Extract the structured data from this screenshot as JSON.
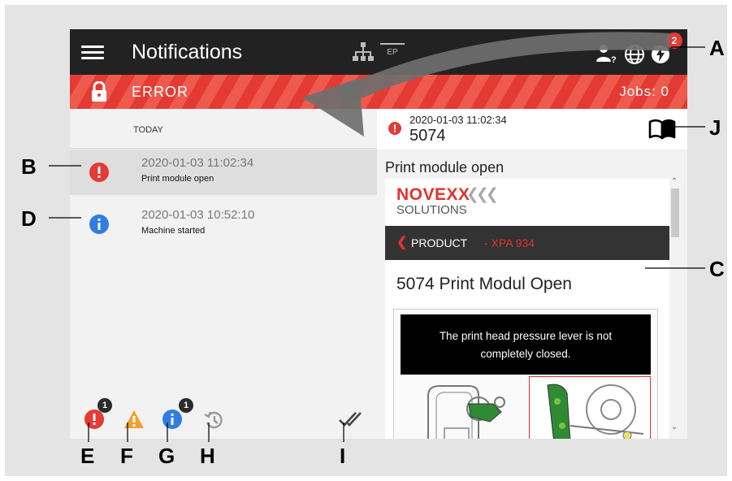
{
  "header": {
    "title": "Notifications",
    "network_mode": "EP",
    "notification_badge": "2",
    "status": "ERROR",
    "jobs": "Jobs: 0"
  },
  "list": {
    "date_group": "TODAY",
    "items": [
      {
        "timestamp": "2020-01-03 11:02:34",
        "message": "Print module open",
        "type": "error"
      },
      {
        "timestamp": "2020-01-03 10:52:10",
        "message": "Machine started",
        "type": "info"
      }
    ]
  },
  "filters": {
    "error_count": "1",
    "info_count": "1"
  },
  "detail": {
    "timestamp": "2020-01-03 11:02:34",
    "code": "5074",
    "title": "Print module open",
    "doc": {
      "brand": "NOVEXX",
      "brand_sub": "SOLUTIONS",
      "product_label": "PRODUCT",
      "product_model": "- XPA 934",
      "heading": "5074 Print Modul Open",
      "caption": "The print head pressure lever is not completely closed."
    }
  },
  "callouts": {
    "A": "A",
    "B": "B",
    "C": "C",
    "D": "D",
    "E": "E",
    "F": "F",
    "G": "G",
    "H": "H",
    "I": "I",
    "J": "J"
  },
  "colors": {
    "error_red": "#e53a35",
    "info_blue": "#2f7de1",
    "warning_orange": "#f0a030",
    "topbar": "#222222"
  },
  "icons": [
    "menu-icon",
    "network-icon",
    "user-help-icon",
    "globe-icon",
    "power-icon",
    "lock-icon",
    "error-icon",
    "info-icon",
    "warning-icon",
    "history-icon",
    "mark-all-read-icon",
    "manual-book-icon"
  ]
}
